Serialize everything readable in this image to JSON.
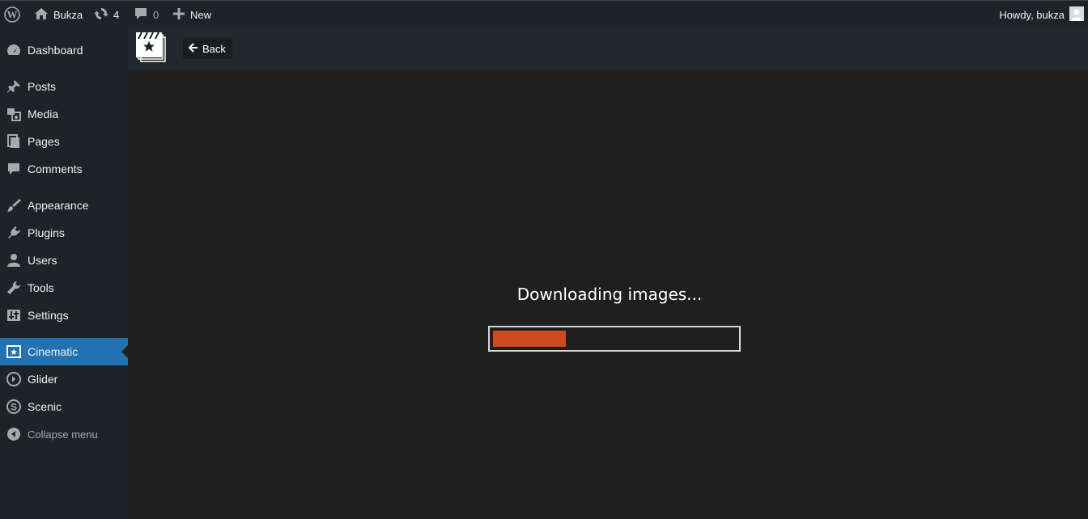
{
  "adminbar": {
    "site_name": "Bukza",
    "updates_count": "4",
    "comments_count": "0",
    "new_label": "New",
    "greeting": "Howdy, bukza"
  },
  "sidebar": {
    "items": [
      {
        "label": "Dashboard",
        "icon": "dashboard-icon"
      },
      {
        "label": "Posts",
        "icon": "pin-icon"
      },
      {
        "label": "Media",
        "icon": "media-icon"
      },
      {
        "label": "Pages",
        "icon": "pages-icon"
      },
      {
        "label": "Comments",
        "icon": "comment-icon"
      },
      {
        "label": "Appearance",
        "icon": "brush-icon"
      },
      {
        "label": "Plugins",
        "icon": "plug-icon"
      },
      {
        "label": "Users",
        "icon": "user-icon"
      },
      {
        "label": "Tools",
        "icon": "wrench-icon"
      },
      {
        "label": "Settings",
        "icon": "sliders-icon"
      },
      {
        "label": "Cinematic",
        "icon": "cinematic-icon"
      },
      {
        "label": "Glider",
        "icon": "glider-icon"
      },
      {
        "label": "Scenic",
        "icon": "scenic-icon"
      }
    ],
    "collapse_label": "Collapse menu",
    "current": "Cinematic"
  },
  "topbar": {
    "back_label": "Back"
  },
  "main": {
    "status_text": "Downloading images...",
    "progress": 0.3
  },
  "colors": {
    "accent": "#2271b1",
    "progress_fill": "#d14a1e",
    "background": "#1f1f1f",
    "sidebar": "#1d2327"
  }
}
